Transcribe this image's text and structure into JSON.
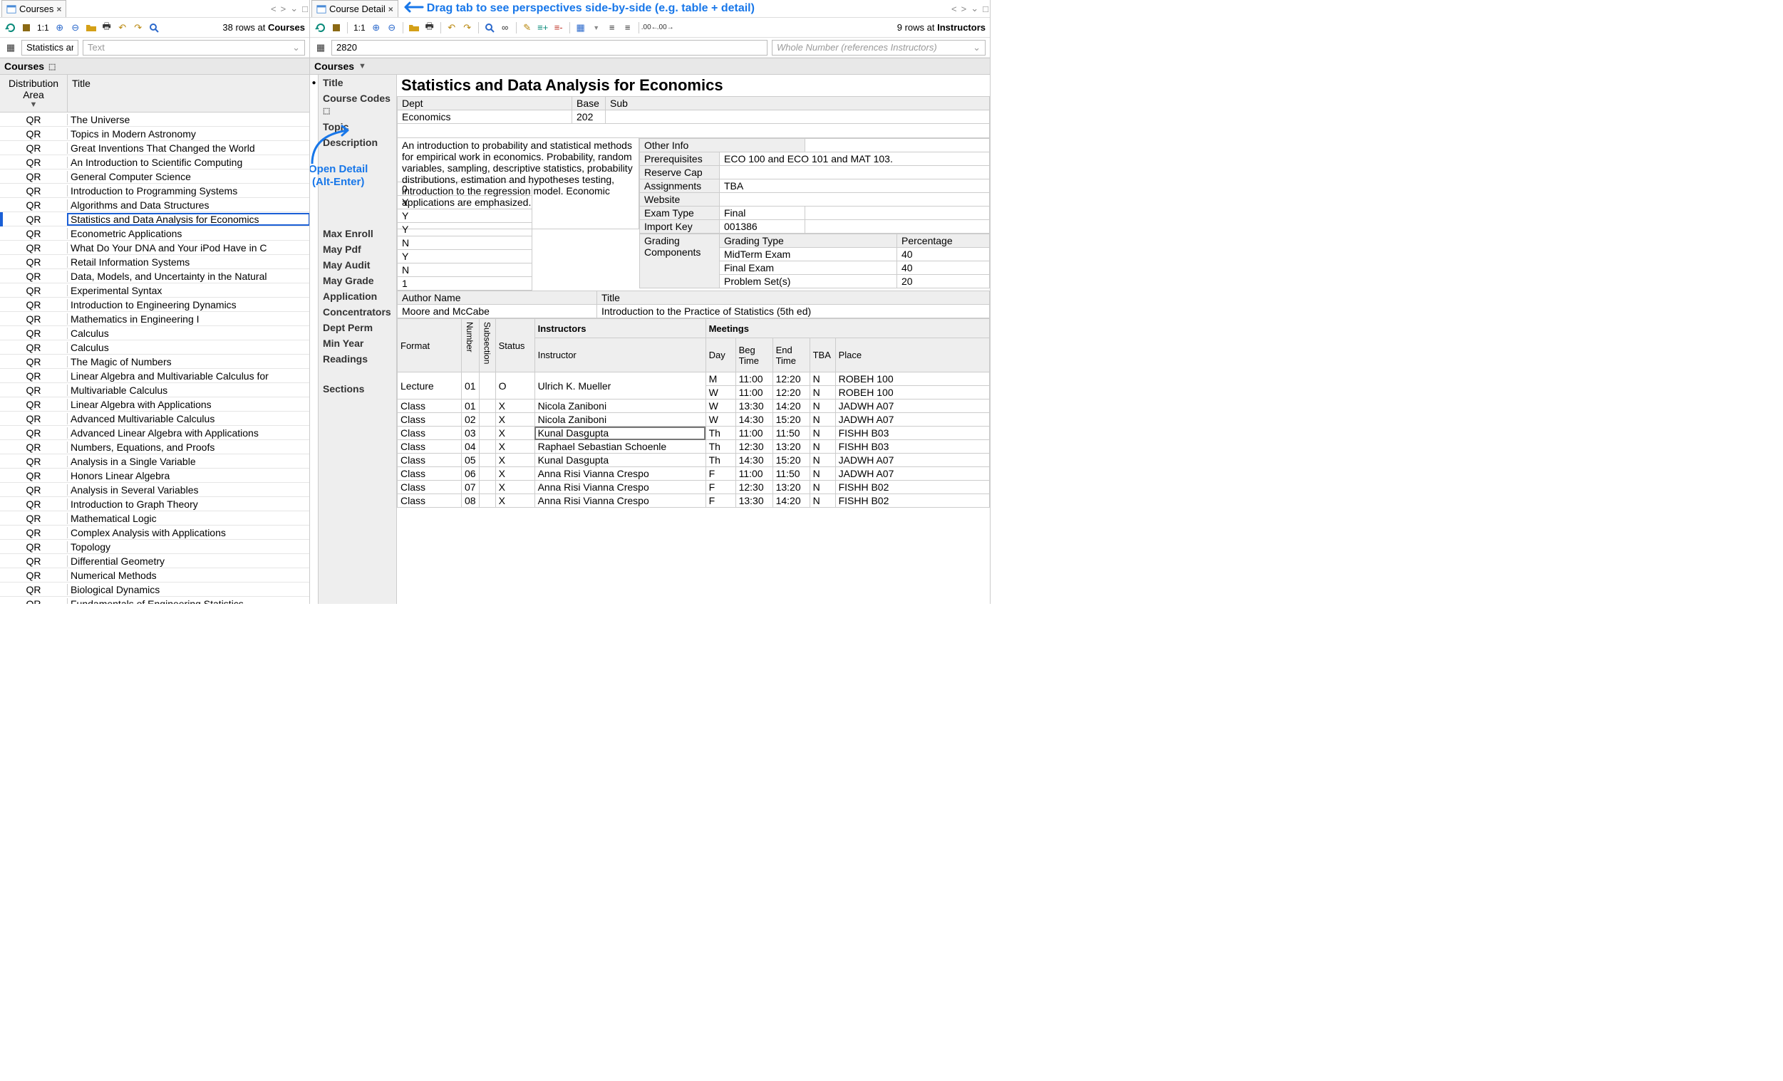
{
  "left": {
    "tab_label": "Courses",
    "status_rows": "38 rows at ",
    "status_table": "Courses",
    "filter_value": "Statistics ar",
    "filter_type_placeholder": "Text",
    "section_label": "Courses",
    "col_dist": "Distribution Area",
    "col_title": "Title",
    "ratio": "1:1",
    "rows": [
      {
        "dist": "QR",
        "title": "The Universe"
      },
      {
        "dist": "QR",
        "title": "Topics in Modern Astronomy"
      },
      {
        "dist": "QR",
        "title": "Great Inventions That Changed the World"
      },
      {
        "dist": "QR",
        "title": "An Introduction to Scientific Computing"
      },
      {
        "dist": "QR",
        "title": "General Computer Science"
      },
      {
        "dist": "QR",
        "title": "Introduction to Programming Systems"
      },
      {
        "dist": "QR",
        "title": "Algorithms and Data Structures"
      },
      {
        "dist": "QR",
        "title": "Statistics and Data Analysis for Economics",
        "selected": true
      },
      {
        "dist": "QR",
        "title": "Econometric Applications"
      },
      {
        "dist": "QR",
        "title": "What Do Your DNA and Your iPod Have in C"
      },
      {
        "dist": "QR",
        "title": "Retail Information Systems"
      },
      {
        "dist": "QR",
        "title": "Data, Models, and Uncertainty in the Natural"
      },
      {
        "dist": "QR",
        "title": "Experimental Syntax"
      },
      {
        "dist": "QR",
        "title": "Introduction to Engineering Dynamics"
      },
      {
        "dist": "QR",
        "title": "Mathematics in Engineering I"
      },
      {
        "dist": "QR",
        "title": "Calculus"
      },
      {
        "dist": "QR",
        "title": "Calculus"
      },
      {
        "dist": "QR",
        "title": "The Magic of Numbers"
      },
      {
        "dist": "QR",
        "title": "Linear Algebra and Multivariable Calculus for"
      },
      {
        "dist": "QR",
        "title": "Multivariable Calculus"
      },
      {
        "dist": "QR",
        "title": "Linear Algebra with Applications"
      },
      {
        "dist": "QR",
        "title": "Advanced Multivariable Calculus"
      },
      {
        "dist": "QR",
        "title": "Advanced Linear Algebra with Applications"
      },
      {
        "dist": "QR",
        "title": "Numbers, Equations, and Proofs"
      },
      {
        "dist": "QR",
        "title": "Analysis in a Single Variable"
      },
      {
        "dist": "QR",
        "title": "Honors Linear Algebra"
      },
      {
        "dist": "QR",
        "title": "Analysis in Several Variables"
      },
      {
        "dist": "QR",
        "title": "Introduction to Graph Theory"
      },
      {
        "dist": "QR",
        "title": "Mathematical Logic"
      },
      {
        "dist": "QR",
        "title": "Complex Analysis with Applications"
      },
      {
        "dist": "QR",
        "title": "Topology"
      },
      {
        "dist": "QR",
        "title": "Differential Geometry"
      },
      {
        "dist": "QR",
        "title": "Numerical Methods"
      },
      {
        "dist": "QR",
        "title": "Biological Dynamics"
      },
      {
        "dist": "QR",
        "title": "Fundamentals of Engineering Statistics"
      }
    ]
  },
  "right": {
    "tab_label": "Course Detail",
    "drag_hint": "Drag tab to see perspectives side-by-side (e.g. table + detail)",
    "status_rows": "9 rows at ",
    "status_table": "Instructors",
    "filter_value": "2820",
    "filter_type_placeholder": "Whole Number (references Instructors)",
    "section_label": "Courses",
    "ratio": "1:1",
    "open_detail_label1": "Open Detail",
    "open_detail_label2": "(Alt-Enter)",
    "title": "Statistics and Data Analysis for Economics",
    "labels": {
      "title": "Title",
      "course_codes": "Course Codes",
      "topic": "Topic",
      "description": "Description",
      "max_enroll": "Max Enroll",
      "may_pdf": "May Pdf",
      "may_audit": "May Audit",
      "may_grade": "May Grade",
      "application": "Application",
      "concentrators": "Concentrators",
      "dept_perm": "Dept Perm",
      "min_year": "Min Year",
      "readings": "Readings",
      "sections": "Sections"
    },
    "course_codes": {
      "dept_h": "Dept",
      "base_h": "Base",
      "sub_h": "Sub",
      "dept": "Economics",
      "base": "202",
      "sub": ""
    },
    "description": "An introduction to probability and statistical methods for empirical work in economics. Probability, random variables, sampling, descriptive statistics, probability distributions, estimation and hypotheses testing, introduction to the regression model. Economic applications are emphasized.",
    "other_info": {
      "header": "Other Info",
      "prereq_l": "Prerequisites",
      "prereq_v": "ECO 100 and ECO 101 and MAT 103.",
      "rescap_l": "Reserve Cap",
      "rescap_v": "",
      "assign_l": "Assignments",
      "assign_v": "TBA",
      "web_l": "Website",
      "web_v": "",
      "exam_l": "Exam Type",
      "exam_v": "Final",
      "import_l": "Import Key",
      "import_v": "001386"
    },
    "grading": {
      "label": "Grading Components",
      "type_h": "Grading Type",
      "pct_h": "Percentage",
      "rows": [
        {
          "type": "MidTerm Exam",
          "pct": "40"
        },
        {
          "type": "Final Exam",
          "pct": "40"
        },
        {
          "type": "Problem Set(s)",
          "pct": "20"
        }
      ]
    },
    "misc": {
      "max_enroll": "0",
      "may_pdf": "Y",
      "may_audit": "Y",
      "may_grade": "Y",
      "application": "N",
      "concentrators": "Y",
      "dept_perm": "N",
      "min_year": "1"
    },
    "readings": {
      "author_h": "Author Name",
      "title_h": "Title",
      "author": "Moore and McCabe",
      "title": "Introduction to the Practice of Statistics (5th ed)"
    },
    "sections_h": {
      "format": "Format",
      "number": "Number",
      "subsection": "Subsection",
      "status": "Status",
      "instructors": "Instructors",
      "instructor": "Instructor",
      "meetings": "Meetings",
      "day": "Day",
      "beg": "Beg Time",
      "end": "End Time",
      "tba": "TBA",
      "place": "Place"
    },
    "sections": [
      {
        "format": "Lecture",
        "num": "01",
        "sub": "",
        "status": "O",
        "instr": "Ulrich K. Mueller",
        "meet": [
          {
            "day": "M",
            "beg": "11:00",
            "end": "12:20",
            "tba": "N",
            "place": "ROBEH 100"
          },
          {
            "day": "W",
            "beg": "11:00",
            "end": "12:20",
            "tba": "N",
            "place": "ROBEH 100"
          }
        ]
      },
      {
        "format": "Class",
        "num": "01",
        "sub": "",
        "status": "X",
        "instr": "Nicola Zaniboni",
        "meet": [
          {
            "day": "W",
            "beg": "13:30",
            "end": "14:20",
            "tba": "N",
            "place": "JADWH A07"
          }
        ]
      },
      {
        "format": "Class",
        "num": "02",
        "sub": "",
        "status": "X",
        "instr": "Nicola Zaniboni",
        "meet": [
          {
            "day": "W",
            "beg": "14:30",
            "end": "15:20",
            "tba": "N",
            "place": "JADWH A07"
          }
        ]
      },
      {
        "format": "Class",
        "num": "03",
        "sub": "",
        "status": "X",
        "instr": "Kunal Dasgupta",
        "hl": true,
        "meet": [
          {
            "day": "Th",
            "beg": "11:00",
            "end": "11:50",
            "tba": "N",
            "place": "FISHH B03"
          }
        ]
      },
      {
        "format": "Class",
        "num": "04",
        "sub": "",
        "status": "X",
        "instr": "Raphael Sebastian Schoenle",
        "meet": [
          {
            "day": "Th",
            "beg": "12:30",
            "end": "13:20",
            "tba": "N",
            "place": "FISHH B03"
          }
        ]
      },
      {
        "format": "Class",
        "num": "05",
        "sub": "",
        "status": "X",
        "instr": "Kunal Dasgupta",
        "meet": [
          {
            "day": "Th",
            "beg": "14:30",
            "end": "15:20",
            "tba": "N",
            "place": "JADWH A07"
          }
        ]
      },
      {
        "format": "Class",
        "num": "06",
        "sub": "",
        "status": "X",
        "instr": "Anna Risi Vianna Crespo",
        "meet": [
          {
            "day": "F",
            "beg": "11:00",
            "end": "11:50",
            "tba": "N",
            "place": "JADWH A07"
          }
        ]
      },
      {
        "format": "Class",
        "num": "07",
        "sub": "",
        "status": "X",
        "instr": "Anna Risi Vianna Crespo",
        "meet": [
          {
            "day": "F",
            "beg": "12:30",
            "end": "13:20",
            "tba": "N",
            "place": "FISHH B02"
          }
        ]
      },
      {
        "format": "Class",
        "num": "08",
        "sub": "",
        "status": "X",
        "instr": "Anna Risi Vianna Crespo",
        "meet": [
          {
            "day": "F",
            "beg": "13:30",
            "end": "14:20",
            "tba": "N",
            "place": "FISHH B02"
          }
        ]
      }
    ]
  }
}
